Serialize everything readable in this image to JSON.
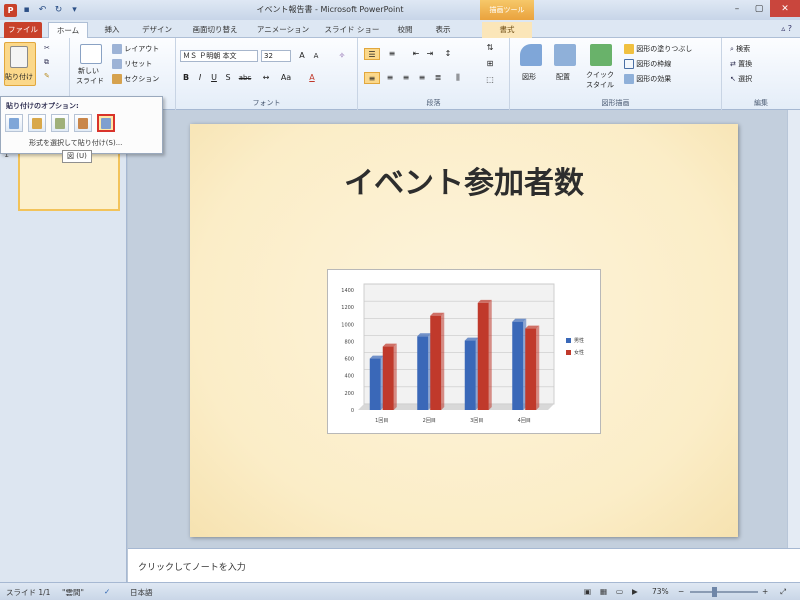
{
  "window": {
    "title": "イベント報告書 - Microsoft PowerPoint",
    "context_tab_header": "描画ツール"
  },
  "tabs": [
    "ファイル",
    "ホーム",
    "挿入",
    "デザイン",
    "画面切り替え",
    "アニメーション",
    "スライド ショー",
    "校閲",
    "表示",
    "書式"
  ],
  "ribbon": {
    "clipboard": {
      "paste_label": "貼り付け"
    },
    "slides": {
      "new_slide_label": "新しい",
      "new_slide_label2": "スライド",
      "layout": "レイアウト",
      "reset": "リセット",
      "section": "セクション"
    },
    "font": {
      "font_name": "ＭＳ Ｐ明朝 本文",
      "font_size": "32",
      "label": "フォント",
      "bold": "B",
      "italic": "I",
      "underline": "U",
      "shadow": "S",
      "strike": "abc"
    },
    "paragraph": {
      "label": "段落"
    },
    "drawing": {
      "shapes": "図形",
      "arrange": "配置",
      "quick_styles": "クイック",
      "quick_styles2": "スタイル",
      "fill": "図形の塗りつぶし",
      "outline": "図形の枠線",
      "effects": "図形の効果",
      "label": "図形描画"
    },
    "editing": {
      "find": "検索",
      "replace": "置換",
      "select": "選択",
      "label": "編集"
    }
  },
  "paste_popup": {
    "title": "貼り付けのオプション:",
    "special": "形式を選択して貼り付け(S)...",
    "tooltip": "図 (U)"
  },
  "slide": {
    "title": "イベント参加者数"
  },
  "chart_data": {
    "type": "bar",
    "categories": [
      "1回目",
      "2回目",
      "3回目",
      "4回目"
    ],
    "series": [
      {
        "name": "男性",
        "values": [
          600,
          860,
          810,
          1030
        ]
      },
      {
        "name": "女性",
        "values": [
          740,
          1100,
          1250,
          950
        ]
      }
    ],
    "ylim": [
      0,
      1400
    ],
    "yticks": [
      0,
      200,
      400,
      600,
      800,
      1000,
      1200,
      1400
    ],
    "colors": [
      "#3a68b8",
      "#c0392b"
    ],
    "legend": "right"
  },
  "notes_placeholder": "クリックしてノートを入力",
  "status": {
    "slide_count": "スライド 1/1",
    "theme": "\"雲間\"",
    "language": "日本語",
    "zoom": "73%"
  }
}
